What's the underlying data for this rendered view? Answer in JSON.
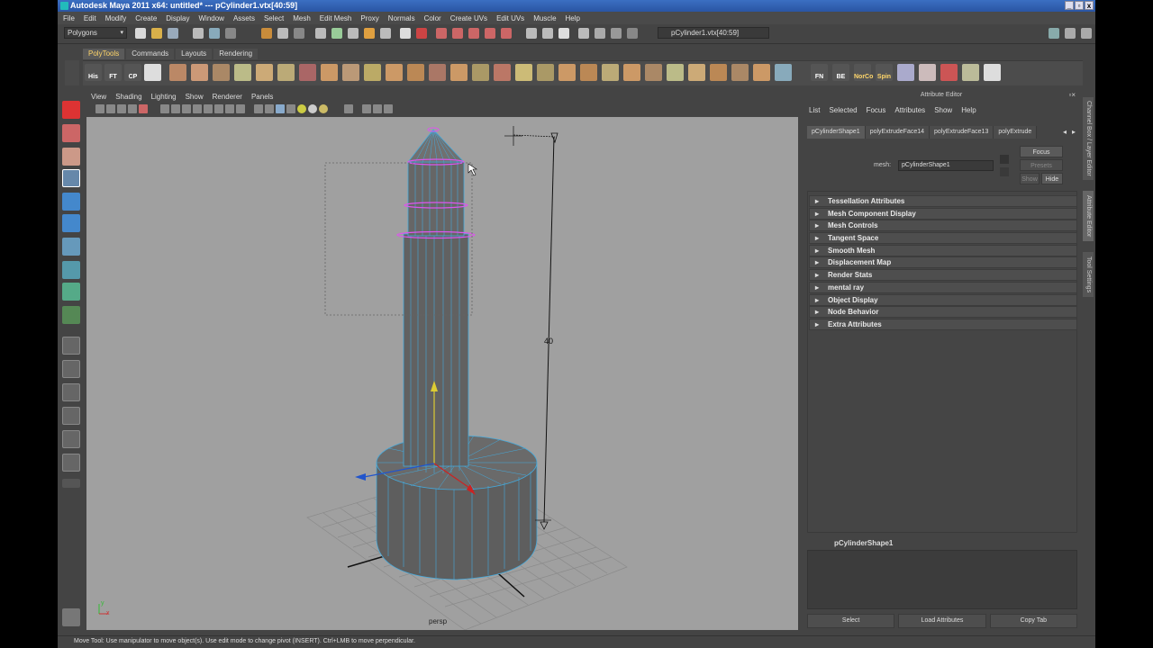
{
  "window": {
    "title": "Autodesk Maya 2011 x64: untitled*   ---   pCylinder1.vtx[40:59]",
    "buttons": [
      "_",
      "▫",
      "x"
    ]
  },
  "menubar": [
    "File",
    "Edit",
    "Modify",
    "Create",
    "Display",
    "Window",
    "Assets",
    "Select",
    "Mesh",
    "Edit Mesh",
    "Proxy",
    "Normals",
    "Color",
    "Create UVs",
    "Edit UVs",
    "Muscle",
    "Help"
  ],
  "statusline": {
    "mode": "Polygons",
    "selection_field": "pCylinder1.vtx[40:59]"
  },
  "shelf": {
    "tabs": [
      "PolyTools",
      "Commands",
      "Layouts",
      "Rendering"
    ],
    "active_tab": "PolyTools",
    "labeled_icons": [
      "His",
      "FT",
      "CP",
      "FN",
      "BE",
      "NorCo",
      "Spin"
    ]
  },
  "viewport": {
    "menu": [
      "View",
      "Shading",
      "Lighting",
      "Show",
      "Renderer",
      "Panels"
    ],
    "camera": "persp",
    "dimension_value": "40",
    "axis_y": "y",
    "axis_x": "x"
  },
  "attribute_editor": {
    "title": "Attribute Editor",
    "menu": [
      "List",
      "Selected",
      "Focus",
      "Attributes",
      "Show",
      "Help"
    ],
    "tabs": [
      "pCylinderShape1",
      "polyExtrudeFace14",
      "polyExtrudeFace13",
      "polyExtrude"
    ],
    "active_tab": "pCylinderShape1",
    "mesh_label": "mesh:",
    "mesh_value": "pCylinderShape1",
    "focus_button": "Focus",
    "presets_button": "Presets",
    "show_button": "Show",
    "hide_button": "Hide",
    "sections": [
      "Tessellation Attributes",
      "Mesh Component Display",
      "Mesh Controls",
      "Tangent Space",
      "Smooth Mesh",
      "Displacement Map",
      "Render Stats",
      "mental ray",
      "Object Display",
      "Node Behavior",
      "Extra Attributes"
    ],
    "notes_label": "pCylinderShape1",
    "bottom_buttons": [
      "Select",
      "Load Attributes",
      "Copy Tab"
    ]
  },
  "side_tabs": [
    "Channel Box / Layer Editor",
    "Attribute Editor",
    "Tool Settings"
  ],
  "helpline": "Move Tool: Use manipulator to move object(s). Use edit mode to change pivot (INSERT).  Ctrl+LMB to move perpendicular."
}
